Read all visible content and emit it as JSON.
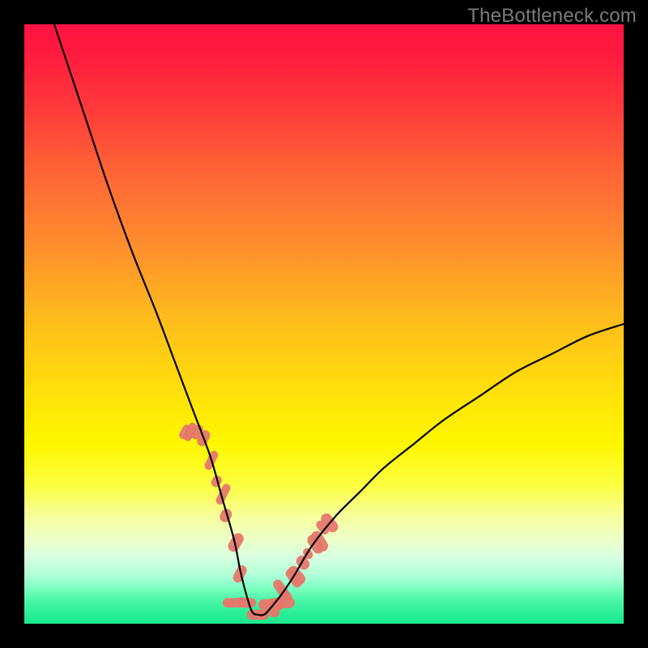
{
  "watermark": "TheBottleneck.com",
  "chart_data": {
    "type": "line",
    "title": "",
    "xlabel": "",
    "ylabel": "",
    "xlim": [
      0,
      100
    ],
    "ylim": [
      0,
      100
    ],
    "notes": "Bottleneck-style V-curve over rainbow gradient. Minimum (≈0) at x≈38. Left branch rises to ≈100 at x≈5; right branch rises to ≈50 at x=100. Salmon cluster blobs near the minimum on both branches.",
    "series": [
      {
        "name": "curve",
        "x": [
          5,
          10,
          14,
          18,
          22,
          25,
          28,
          31,
          33,
          35,
          36,
          37,
          38,
          39,
          40,
          41,
          43,
          45,
          48,
          52,
          56,
          60,
          65,
          70,
          76,
          82,
          88,
          94,
          100
        ],
        "values": [
          100,
          85,
          73,
          62,
          52,
          44,
          36,
          28,
          21,
          14,
          9,
          5,
          2,
          1.5,
          1.5,
          2.5,
          5,
          8,
          13,
          18,
          22,
          26,
          30,
          34,
          38,
          42,
          45,
          48,
          50
        ]
      }
    ],
    "clusters": {
      "left": {
        "x_range": [
          27,
          36
        ],
        "y_range": [
          7,
          32
        ]
      },
      "right": {
        "x_range": [
          41,
          51
        ],
        "y_range": [
          2.5,
          22
        ]
      },
      "floor": {
        "x_range": [
          34,
          43
        ],
        "y_range": [
          1.5,
          3.5
        ]
      }
    },
    "colors": {
      "curve": "#000000",
      "cluster": "#e5786d",
      "gradient_top": "#ff1242",
      "gradient_mid": "#ffe209",
      "gradient_bottom": "#1ce98f",
      "frame": "#000000"
    }
  }
}
